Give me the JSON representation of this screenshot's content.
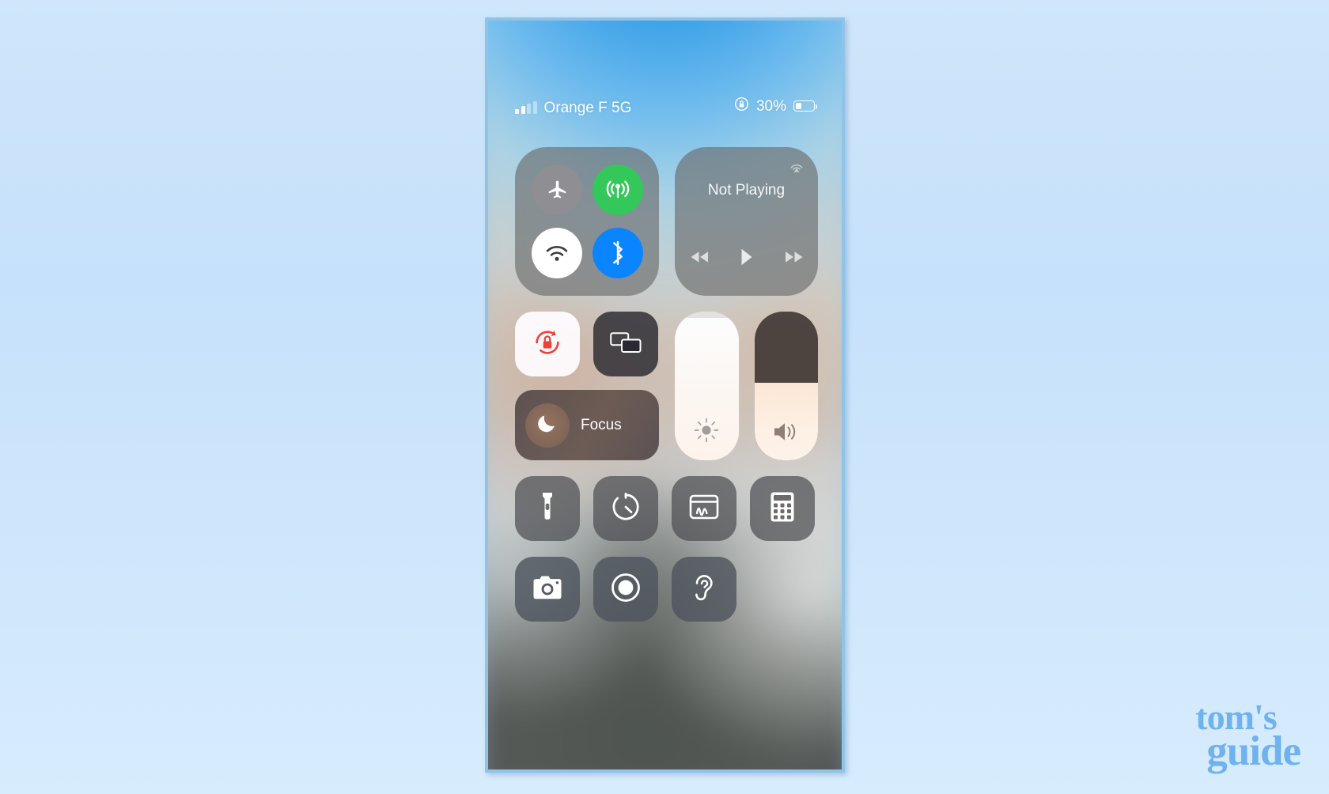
{
  "theme": {
    "page_background": "#cbe3fb",
    "phone_frame": "#8fc4e8",
    "accent_green": "#34c759",
    "accent_blue": "#0a84ff",
    "rotation_lock_red": "#f0403a",
    "watermark_blue": "#6fb2ee",
    "panel_gray": "rgba(104,104,104,0.62)"
  },
  "status_bar": {
    "carrier": "Orange F 5G",
    "signal_bars_filled": 2,
    "signal_bars_total": 4,
    "rotation_lock_indicator": "rotation-lock-icon",
    "battery_percent_label": "30%",
    "battery_percent_value": 30
  },
  "control_center": {
    "connectivity": {
      "toggles": [
        {
          "name": "airplane-mode",
          "icon": "airplane-icon",
          "state": "off",
          "color": "#8e8e93"
        },
        {
          "name": "cellular-data",
          "icon": "cellular-antenna-icon",
          "state": "on",
          "color": "#34c759"
        },
        {
          "name": "wifi",
          "icon": "wifi-icon",
          "state": "off",
          "color": "#ffffff"
        },
        {
          "name": "bluetooth",
          "icon": "bluetooth-icon",
          "state": "on",
          "color": "#0a84ff"
        }
      ]
    },
    "media": {
      "title": "Not Playing",
      "airplay_icon": "airplay-icon",
      "controls": [
        {
          "name": "rewind",
          "icon": "rewind-icon"
        },
        {
          "name": "play",
          "icon": "play-icon"
        },
        {
          "name": "fast-forward",
          "icon": "fast-forward-icon"
        }
      ]
    },
    "tiles": {
      "rotation_lock": {
        "icon": "rotation-lock-icon",
        "state": "on",
        "label": ""
      },
      "screen_mirroring": {
        "icon": "screen-mirroring-icon",
        "state": "off",
        "label": ""
      },
      "focus": {
        "icon": "moon-icon",
        "label": "Focus",
        "state": "off"
      }
    },
    "sliders": {
      "brightness": {
        "icon": "brightness-icon",
        "value": 96,
        "unit": "%"
      },
      "volume": {
        "icon": "volume-icon",
        "value": 52,
        "unit": "%"
      }
    },
    "shortcuts_row_1": [
      {
        "name": "flashlight",
        "icon": "flashlight-icon"
      },
      {
        "name": "timer",
        "icon": "timer-icon"
      },
      {
        "name": "quick-note",
        "icon": "quick-note-icon"
      },
      {
        "name": "calculator",
        "icon": "calculator-icon"
      }
    ],
    "shortcuts_row_2": [
      {
        "name": "camera",
        "icon": "camera-icon"
      },
      {
        "name": "screen-recording",
        "icon": "screen-record-icon"
      },
      {
        "name": "hearing",
        "icon": "ear-icon"
      }
    ]
  },
  "watermark": {
    "line1": "tom's",
    "line2": "guide"
  }
}
